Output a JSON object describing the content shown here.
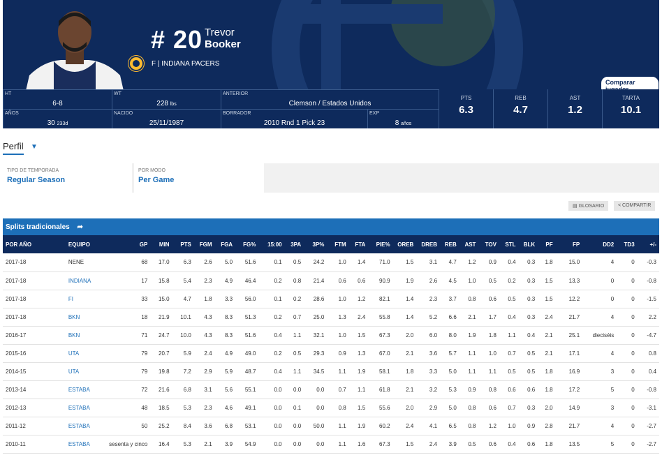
{
  "player": {
    "number": "# 20",
    "first_name": "Trevor",
    "last_name": "Booker",
    "position_team": "F  |  INDIANA PACERS",
    "compare_label": "Comparar jugador"
  },
  "info": {
    "ht": {
      "label": "HT",
      "value": "6-8"
    },
    "wt": {
      "label": "WT",
      "value": "228",
      "unit": "lbs"
    },
    "anterior": {
      "label": "ANTERIOR",
      "value": "Clemson / Estados Unidos"
    },
    "anos": {
      "label": "AÑOS",
      "value": "30",
      "unit": "233d"
    },
    "nacido": {
      "label": "NACIDO",
      "value": "25/11/1987"
    },
    "borrador": {
      "label": "BORRADOR",
      "value": "2010 Rnd 1 Pick 23"
    },
    "exp": {
      "label": "EXP",
      "value": "8",
      "unit": "años"
    },
    "stats": [
      {
        "label": "PTS",
        "value": "6.3"
      },
      {
        "label": "REB",
        "value": "4.7"
      },
      {
        "label": "AST",
        "value": "1.2"
      },
      {
        "label": "TARTA",
        "value": "10.1"
      }
    ]
  },
  "perfil_label": "Perfil",
  "filters": [
    {
      "label": "TIPO DE TEMPORADA",
      "value": "Regular Season"
    },
    {
      "label": "POR MODO",
      "value": "Per Game"
    }
  ],
  "tools": {
    "glossary": "GLOSARIO",
    "share": "COMPARTIR"
  },
  "table": {
    "title": "Splits tradicionales",
    "headers": [
      "POR AÑO",
      "EQUIPO",
      "GP",
      "MIN",
      "PTS",
      "FGM",
      "FGA",
      "FG%",
      "15:00",
      "3PA",
      "3P%",
      "FTM",
      "FTA",
      "PIE%",
      "OREB",
      "DREB",
      "REB",
      "AST",
      "TOV",
      "STL",
      "BLK",
      "PF",
      "FP",
      "DD2",
      "TD3",
      "+/-"
    ],
    "rows": [
      [
        "2017-18",
        "NENE",
        "68",
        "17.0",
        "6.3",
        "2.6",
        "5.0",
        "51.6",
        "0.1",
        "0.5",
        "24.2",
        "1.0",
        "1.4",
        "71.0",
        "1.5",
        "3.1",
        "4.7",
        "1.2",
        "0.9",
        "0.4",
        "0.3",
        "1.8",
        "15.0",
        "4",
        "0",
        "-0.3"
      ],
      [
        "2017-18",
        "INDIANA",
        "17",
        "15.8",
        "5.4",
        "2.3",
        "4.9",
        "46.4",
        "0.2",
        "0.8",
        "21.4",
        "0.6",
        "0.6",
        "90.9",
        "1.9",
        "2.6",
        "4.5",
        "1.0",
        "0.5",
        "0.2",
        "0.3",
        "1.5",
        "13.3",
        "0",
        "0",
        "-0.8"
      ],
      [
        "2017-18",
        "FI",
        "33",
        "15.0",
        "4.7",
        "1.8",
        "3.3",
        "56.0",
        "0.1",
        "0.2",
        "28.6",
        "1.0",
        "1.2",
        "82.1",
        "1.4",
        "2.3",
        "3.7",
        "0.8",
        "0.6",
        "0.5",
        "0.3",
        "1.5",
        "12.2",
        "0",
        "0",
        "-1.5"
      ],
      [
        "2017-18",
        "BKN",
        "18",
        "21.9",
        "10.1",
        "4.3",
        "8.3",
        "51.3",
        "0.2",
        "0.7",
        "25.0",
        "1.3",
        "2.4",
        "55.8",
        "1.4",
        "5.2",
        "6.6",
        "2.1",
        "1.7",
        "0.4",
        "0.3",
        "2.4",
        "21.7",
        "4",
        "0",
        "2.2"
      ],
      [
        "2016-17",
        "BKN",
        "71",
        "24.7",
        "10.0",
        "4.3",
        "8.3",
        "51.6",
        "0.4",
        "1.1",
        "32.1",
        "1.0",
        "1.5",
        "67.3",
        "2.0",
        "6.0",
        "8.0",
        "1.9",
        "1.8",
        "1.1",
        "0.4",
        "2.1",
        "25.1",
        "dieciséis",
        "0",
        "-4.7"
      ],
      [
        "2015-16",
        "UTA",
        "79",
        "20.7",
        "5.9",
        "2.4",
        "4.9",
        "49.0",
        "0.2",
        "0.5",
        "29.3",
        "0.9",
        "1.3",
        "67.0",
        "2.1",
        "3.6",
        "5.7",
        "1.1",
        "1.0",
        "0.7",
        "0.5",
        "2.1",
        "17.1",
        "4",
        "0",
        "0.8"
      ],
      [
        "2014-15",
        "UTA",
        "79",
        "19.8",
        "7.2",
        "2.9",
        "5.9",
        "48.7",
        "0.4",
        "1.1",
        "34.5",
        "1.1",
        "1.9",
        "58.1",
        "1.8",
        "3.3",
        "5.0",
        "1.1",
        "1.1",
        "0.5",
        "0.5",
        "1.8",
        "16.9",
        "3",
        "0",
        "0.4"
      ],
      [
        "2013-14",
        "ESTABA",
        "72",
        "21.6",
        "6.8",
        "3.1",
        "5.6",
        "55.1",
        "0.0",
        "0.0",
        "0.0",
        "0.7",
        "1.1",
        "61.8",
        "2.1",
        "3.2",
        "5.3",
        "0.9",
        "0.8",
        "0.6",
        "0.6",
        "1.8",
        "17.2",
        "5",
        "0",
        "-0.8"
      ],
      [
        "2012-13",
        "ESTABA",
        "48",
        "18.5",
        "5.3",
        "2.3",
        "4.6",
        "49.1",
        "0.0",
        "0.1",
        "0.0",
        "0.8",
        "1.5",
        "55.6",
        "2.0",
        "2.9",
        "5.0",
        "0.8",
        "0.6",
        "0.7",
        "0.3",
        "2.0",
        "14.9",
        "3",
        "0",
        "-3.1"
      ],
      [
        "2011-12",
        "ESTABA",
        "50",
        "25.2",
        "8.4",
        "3.6",
        "6.8",
        "53.1",
        "0.0",
        "0.0",
        "50.0",
        "1.1",
        "1.9",
        "60.2",
        "2.4",
        "4.1",
        "6.5",
        "0.8",
        "1.2",
        "1.0",
        "0.9",
        "2.8",
        "21.7",
        "4",
        "0",
        "-2.7"
      ],
      [
        "2010-11",
        "ESTABA",
        "sesenta y cinco",
        "16.4",
        "5.3",
        "2.1",
        "3.9",
        "54.9",
        "0.0",
        "0.0",
        "0.0",
        "1.1",
        "1.6",
        "67.3",
        "1.5",
        "2.4",
        "3.9",
        "0.5",
        "0.6",
        "0.4",
        "0.6",
        "1.8",
        "13.5",
        "5",
        "0",
        "-2.7"
      ]
    ]
  },
  "colors": {
    "navy": "#0e2a5c",
    "blue": "#1d6fb8",
    "gold": "#fdbb30"
  },
  "icons": {
    "share": "share-arrow-icon",
    "caret": "caret-down-icon",
    "book": "book-icon"
  }
}
